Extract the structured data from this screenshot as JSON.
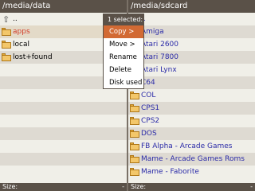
{
  "left_pane": {
    "path": "/media/data",
    "up_label": "..",
    "items": [
      {
        "label": "apps",
        "icon": "folder-icon"
      },
      {
        "label": "local",
        "icon": "folder-icon"
      },
      {
        "label": "lost+found",
        "icon": "folder-icon"
      }
    ],
    "footer_size_label": "Size:",
    "footer_size_value": "-"
  },
  "right_pane": {
    "path": "/media/sdcard",
    "up_label": "..",
    "items": [
      {
        "label": "Amiga",
        "icon": "folder-icon"
      },
      {
        "label": "Atari 2600",
        "icon": "folder-icon"
      },
      {
        "label": "Atari 7800",
        "icon": "folder-icon"
      },
      {
        "label": "Atari Lynx",
        "icon": "folder-icon"
      },
      {
        "label": "C64",
        "icon": "folder-icon"
      },
      {
        "label": "COL",
        "icon": "folder-icon"
      },
      {
        "label": "CPS1",
        "icon": "folder-icon"
      },
      {
        "label": "CPS2",
        "icon": "folder-icon"
      },
      {
        "label": "DOS",
        "icon": "folder-icon"
      },
      {
        "label": "FB Alpha - Arcade Games",
        "icon": "folder-icon"
      },
      {
        "label": "Mame - Arcade Games Roms",
        "icon": "folder-icon"
      },
      {
        "label": "Mame - Faborite",
        "icon": "folder-icon"
      }
    ],
    "footer_size_label": "Size:",
    "footer_size_value": "-"
  },
  "context_menu": {
    "title": "1 selected:",
    "items": [
      {
        "label": "Copy >"
      },
      {
        "label": "Move >"
      },
      {
        "label": "Rename"
      },
      {
        "label": "Delete"
      },
      {
        "label": "Disk used"
      }
    ],
    "active_index": 0
  },
  "colors": {
    "header_bg": "#5a5148",
    "selected_text": "#d23c28",
    "menu_highlight": "#d26a34",
    "right_text": "#2b2ba8"
  }
}
